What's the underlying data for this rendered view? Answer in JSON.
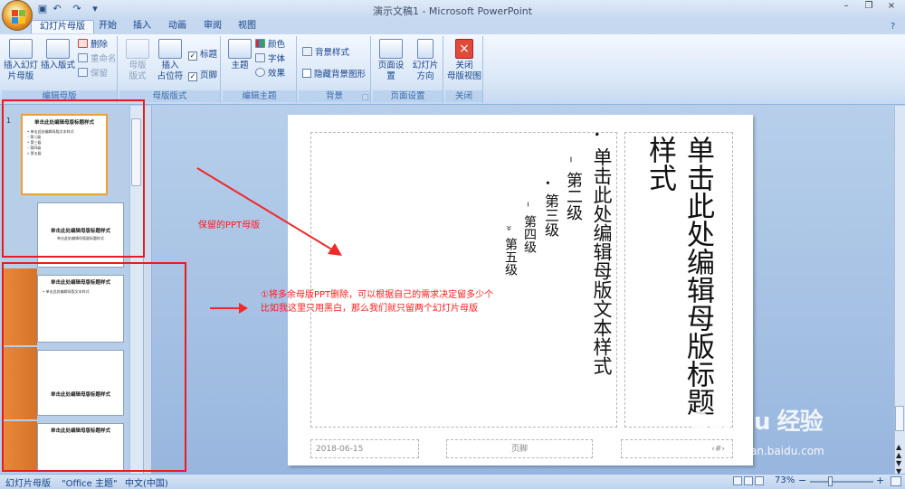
{
  "window": {
    "title": "演示文稿1 - Microsoft PowerPoint",
    "qat_undo": "↶",
    "qat_redo": "↷",
    "qat_save": "▣",
    "qat_more": "▾",
    "minimize": "–",
    "restore": "❐",
    "close": "×",
    "help": "?"
  },
  "tabs": [
    {
      "label": "幻灯片母版"
    },
    {
      "label": "开始"
    },
    {
      "label": "插入"
    },
    {
      "label": "动画"
    },
    {
      "label": "审阅"
    },
    {
      "label": "视图"
    }
  ],
  "ribbon": {
    "edit_master": {
      "label": "编辑母版",
      "insert_slide_master": "插入幻灯\n片母版",
      "insert_layout": "插入版式",
      "delete": "删除",
      "rename": "重命名",
      "preserve": "保留"
    },
    "master_layout": {
      "label": "母版版式",
      "master_layout_btn": "母版\n版式",
      "insert_placeholder": "插入\n占位符",
      "title": "标题",
      "footer": "页脚"
    },
    "edit_theme": {
      "label": "编辑主题",
      "themes": "主题",
      "colors": "颜色",
      "fonts": "字体",
      "effects": "效果"
    },
    "background": {
      "label": "背景",
      "bg_styles": "背景样式",
      "hide_bg": "隐藏背景图形"
    },
    "page_setup": {
      "label": "页面设置",
      "page_setup_btn": "页面设置",
      "orientation": "幻灯片\n方向"
    },
    "close": {
      "label": "关闭",
      "close_master": "关闭\n母版视图"
    }
  },
  "thumbnails": {
    "number": "1",
    "master_title": "单击此处编辑母版标题样式",
    "master_lines": [
      "• 单击此处编辑母版文本样式",
      "  – 第二级",
      "    • 第三级",
      "      – 第四级",
      "        » 第五级"
    ],
    "layout_title": "单击此处编辑母版标题样式",
    "layout_sub": "单击此处编辑母版副标题样式",
    "t3_title": "单击此处编辑母版标题样式",
    "t3_line": "• 单击此处编辑母版文本样式",
    "t4_title": "单击此处编辑母版标题样式",
    "t5_title": "单击此处编辑母版标题样式"
  },
  "slide": {
    "title": "单击此处编辑母版标题样式",
    "body_l1": "单击此处编辑母版文本样式",
    "body_l2": "第二级",
    "body_l3": "第三级",
    "body_l4": "第四级",
    "body_l5": "第五级",
    "bullet1": "•",
    "bullet2": "–",
    "bullet3": "•",
    "bullet4": "–",
    "bullet5": "»",
    "date": "2018-06-15",
    "footer": "页脚",
    "page_num": "‹#›"
  },
  "annotations": {
    "keep_label": "保留的PPT母版",
    "note": "①将多余母版PPT删除，可以根据自己的需求决定留多少个\n比如我这里只用黑白，那么我们就只留两个幻灯片母版"
  },
  "watermark": {
    "brand": "Bai du 经验",
    "url": "jingyan.baidu.com"
  },
  "status": {
    "view": "幻灯片母版",
    "theme": "\"Office 主题\"",
    "language": "中文(中国)",
    "zoom": "73%",
    "zoom_minus": "−",
    "zoom_plus": "+"
  },
  "colors": {
    "annotation": "#ff1a1a",
    "ribbon_text": "#15428b"
  }
}
